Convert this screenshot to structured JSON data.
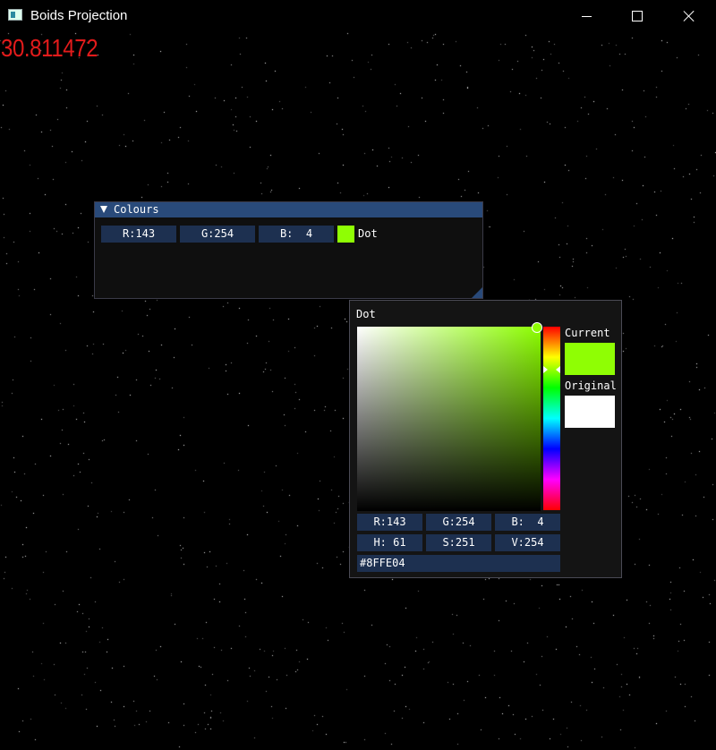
{
  "window": {
    "title": "Boids Projection"
  },
  "overlay": {
    "fps": "30.811472"
  },
  "colours_window": {
    "title": "Colours",
    "r": "R:143",
    "g": "G:254",
    "b": "B:  4",
    "label": "Dot",
    "color": "#8FFE04"
  },
  "picker": {
    "title": "Dot",
    "current_label": "Current",
    "original_label": "Original",
    "current_color": "#8FFE04",
    "original_color": "#FFFFFF",
    "r": "R:143",
    "g": "G:254",
    "b": "B:  4",
    "h": "H: 61",
    "s": "S:251",
    "v": "V:254",
    "hex": "#8FFE04"
  },
  "colors": {
    "background": "#000000",
    "fps_text": "#E21B1B",
    "imgui_title_bg": "#294A7A",
    "imgui_frame_bg": "#1D3050",
    "stars": "#FFFFFF"
  },
  "icons": [
    "app-icon",
    "minimize-icon",
    "maximize-icon",
    "close-icon",
    "collapse-arrow-icon"
  ]
}
